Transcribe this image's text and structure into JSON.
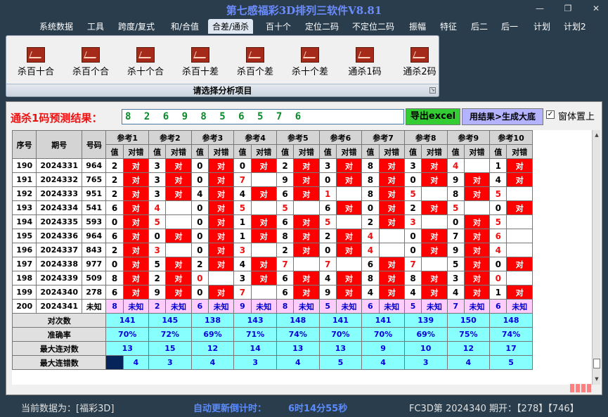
{
  "window": {
    "title": "第七感福彩3D排列三软件V8.81"
  },
  "menu": [
    "系统数据",
    "工具",
    "跨度/复式",
    "和/合值",
    "合差/通杀",
    "百十个",
    "定位二码",
    "不定位二码",
    "振幅",
    "特征",
    "后二",
    "后一",
    "计划",
    "计划2"
  ],
  "menu_active_index": 4,
  "ribbon": {
    "buttons": [
      "杀百十合",
      "杀百个合",
      "杀十个合",
      "杀百十差",
      "杀百个差",
      "杀十个差",
      "通杀1码",
      "通杀2码"
    ],
    "group_label": "请选择分析项目"
  },
  "prediction": {
    "label": "通杀1码预测结果：",
    "value": "8 2 6 9 8 5 6 5 7 6",
    "export_label": "导出excel",
    "generate_label": "用结果>生成大底",
    "topmost_checked": true,
    "topmost_label": "窗体置上"
  },
  "table": {
    "headers": {
      "seq": "序号",
      "issue": "期号",
      "code": "号码",
      "value": "值",
      "match": "对错"
    },
    "refs": [
      "参考1",
      "参考2",
      "参考3",
      "参考4",
      "参考5",
      "参考6",
      "参考7",
      "参考8",
      "参考9",
      "参考10"
    ],
    "hit_text": "对",
    "unknown_text": "未知",
    "rows": [
      {
        "seq": "190",
        "issue": "2024331",
        "code": "964",
        "vals": [
          "2",
          "3",
          "0",
          "0",
          "2",
          "3",
          "8",
          "3",
          "4",
          "1"
        ],
        "hit": [
          1,
          1,
          1,
          1,
          1,
          1,
          1,
          1,
          0,
          1
        ],
        "red": [
          0,
          0,
          0,
          0,
          0,
          0,
          0,
          0,
          1,
          0
        ]
      },
      {
        "seq": "191",
        "issue": "2024332",
        "code": "765",
        "vals": [
          "2",
          "3",
          "0",
          "7",
          "9",
          "0",
          "8",
          "0",
          "9",
          "4"
        ],
        "hit": [
          1,
          1,
          1,
          0,
          1,
          1,
          1,
          1,
          1,
          1
        ],
        "red": [
          0,
          0,
          0,
          1,
          0,
          0,
          0,
          0,
          0,
          0
        ]
      },
      {
        "seq": "192",
        "issue": "2024333",
        "code": "951",
        "vals": [
          "2",
          "3",
          "4",
          "4",
          "6",
          "1",
          "8",
          "5",
          "8",
          "5"
        ],
        "hit": [
          1,
          1,
          1,
          1,
          1,
          0,
          1,
          0,
          1,
          0
        ],
        "red": [
          0,
          0,
          0,
          0,
          0,
          1,
          0,
          1,
          0,
          1
        ]
      },
      {
        "seq": "193",
        "issue": "2024334",
        "code": "541",
        "vals": [
          "6",
          "4",
          "0",
          "5",
          "5",
          "6",
          "0",
          "2",
          "5",
          "0"
        ],
        "hit": [
          1,
          0,
          1,
          0,
          0,
          1,
          1,
          1,
          0,
          1
        ],
        "red": [
          0,
          1,
          0,
          1,
          1,
          0,
          0,
          0,
          1,
          0
        ]
      },
      {
        "seq": "194",
        "issue": "2024335",
        "code": "593",
        "vals": [
          "0",
          "5",
          "0",
          "1",
          "6",
          "5",
          "2",
          "3",
          "0",
          "5"
        ],
        "hit": [
          1,
          0,
          1,
          1,
          1,
          0,
          1,
          0,
          1,
          0
        ],
        "red": [
          0,
          1,
          0,
          0,
          0,
          1,
          0,
          1,
          0,
          1
        ]
      },
      {
        "seq": "195",
        "issue": "2024336",
        "code": "964",
        "vals": [
          "6",
          "0",
          "0",
          "1",
          "8",
          "2",
          "4",
          "0",
          "7",
          "6"
        ],
        "hit": [
          1,
          1,
          1,
          1,
          1,
          1,
          0,
          1,
          1,
          0
        ],
        "red": [
          0,
          0,
          0,
          0,
          0,
          0,
          1,
          0,
          0,
          1
        ]
      },
      {
        "seq": "196",
        "issue": "2024337",
        "code": "843",
        "vals": [
          "2",
          "3",
          "0",
          "3",
          "2",
          "0",
          "4",
          "0",
          "9",
          "4"
        ],
        "hit": [
          1,
          0,
          1,
          0,
          1,
          1,
          0,
          1,
          1,
          0
        ],
        "red": [
          0,
          1,
          0,
          1,
          0,
          0,
          1,
          0,
          0,
          1
        ]
      },
      {
        "seq": "197",
        "issue": "2024338",
        "code": "977",
        "vals": [
          "0",
          "5",
          "2",
          "4",
          "7",
          "7",
          "6",
          "7",
          "5",
          "0"
        ],
        "hit": [
          1,
          1,
          1,
          1,
          0,
          0,
          1,
          0,
          1,
          1
        ],
        "red": [
          0,
          0,
          0,
          0,
          1,
          1,
          0,
          1,
          0,
          0
        ]
      },
      {
        "seq": "198",
        "issue": "2024339",
        "code": "509",
        "vals": [
          "8",
          "2",
          "0",
          "3",
          "6",
          "4",
          "8",
          "8",
          "3",
          "0"
        ],
        "hit": [
          1,
          1,
          0,
          1,
          1,
          1,
          1,
          1,
          1,
          0
        ],
        "red": [
          0,
          0,
          1,
          0,
          0,
          0,
          0,
          0,
          0,
          1
        ]
      },
      {
        "seq": "199",
        "issue": "2024340",
        "code": "278",
        "vals": [
          "6",
          "9",
          "0",
          "7",
          "6",
          "9",
          "4",
          "4",
          "4",
          "1"
        ],
        "hit": [
          1,
          1,
          1,
          0,
          1,
          1,
          1,
          1,
          1,
          1
        ],
        "red": [
          0,
          0,
          0,
          1,
          0,
          0,
          0,
          0,
          0,
          0
        ]
      }
    ],
    "current": {
      "seq": "200",
      "issue": "2024341",
      "code": "未知",
      "vals": [
        "8",
        "2",
        "6",
        "9",
        "8",
        "5",
        "6",
        "5",
        "7",
        "6"
      ]
    },
    "summary": [
      {
        "label": "对次数",
        "vals": [
          "141",
          "145",
          "138",
          "143",
          "148",
          "141",
          "141",
          "139",
          "150",
          "148"
        ]
      },
      {
        "label": "准确率",
        "vals": [
          "70%",
          "72%",
          "69%",
          "71%",
          "74%",
          "70%",
          "70%",
          "69%",
          "75%",
          "74%"
        ]
      },
      {
        "label": "最大连对数",
        "vals": [
          "13",
          "15",
          "12",
          "14",
          "13",
          "13",
          "9",
          "10",
          "12",
          "17"
        ]
      },
      {
        "label": "最大连错数",
        "vals": [
          "4",
          "3",
          "4",
          "3",
          "4",
          "5",
          "4",
          "3",
          "4",
          "5"
        ]
      }
    ]
  },
  "status": {
    "data_label": "当前数据为：[福彩3D]",
    "countdown_label": "自动更新倒计时：",
    "countdown_value": "6时14分55秒",
    "draw_info": "FC3D第 2024340 期开：【278】【746】"
  }
}
